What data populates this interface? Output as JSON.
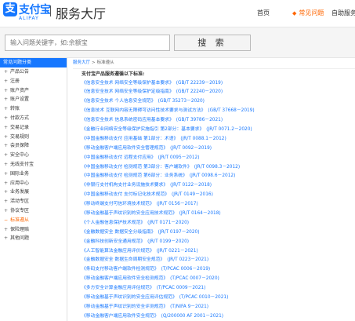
{
  "header": {
    "logo_mark": "支",
    "logo_cn": "支付宝",
    "logo_en": "ALIPAY",
    "site_title": "服务大厅",
    "nav": {
      "home": "首页",
      "faq": "常见问题",
      "self_service": "自助服务"
    }
  },
  "search": {
    "placeholder": "输入问题关键字，如:余额宝",
    "button": "搜 索"
  },
  "sidebar": {
    "title": "常见问题分类",
    "items": [
      "产品公告",
      "注册",
      "账户资产",
      "账户设置",
      "转账",
      "付款方式",
      "交易记录",
      "交易规则",
      "会员保障",
      "安全中心",
      "无线支付宝",
      "国际业务",
      "应用中心",
      "业务发展",
      "活动专区",
      "协议专区",
      "标准遵从",
      "保险理赔",
      "其他问题"
    ],
    "active_index": 16
  },
  "breadcrumb": {
    "root": "服务大厅",
    "separator": ">",
    "current": "标准遵从"
  },
  "content": {
    "intro": "支付宝产品服务遵循以下标准:",
    "standards": [
      {
        "name": "《信息安全技术 网络安全等级保护基本要求》",
        "code": "(GB/T 22239－2019)"
      },
      {
        "name": "《信息安全技术 网络安全等级保护定级指南》",
        "code": "(GB/T 22240－2020)"
      },
      {
        "name": "《信息安全技术 个人信息安全规范》",
        "code": "(GB/T 35273－2020)"
      },
      {
        "name": "《信息技术 互联网内容无障碍可访问性技术要求与测试方法》",
        "code": "(GB/T 37668－2019)"
      },
      {
        "name": "《信息安全技术 信息系统密码应用基本要求》",
        "code": "(GB/T 39786－2021)"
      },
      {
        "name": "《金融行业网络安全等级保护实施指引 第2部分：基本要求》",
        "code": "(JR/T 0071.2－2020)"
      },
      {
        "name": "《中国金融移动支付 应用基础 第1部分：术语》",
        "code": "(JR/T 0088.1－2012)"
      },
      {
        "name": "《移动金融客户端应用软件安全管理规范》",
        "code": "(JR/T 0092－2019)"
      },
      {
        "name": "《中国金融移动支付 远程支付应用》",
        "code": "(JR/T 0095－2012)"
      },
      {
        "name": "《中国金融移动支付 检测规范 第3部分：客户端软件》",
        "code": "(JR/T 0098.3－2012)"
      },
      {
        "name": "《中国金融移动支付 检测规范 第6部分：业务系统》",
        "code": "(JR/T 0098.6－2012)"
      },
      {
        "name": "《非银行支付机构支付业务设施技术要求》",
        "code": "(JR/T 0122－2018)"
      },
      {
        "name": "《中国金融移动支付 支付标记化技术规范》",
        "code": "(JR/T 0149－2016)"
      },
      {
        "name": "《移动终端支付可信环境技术规范》",
        "code": "(JR/T 0156－2017)"
      },
      {
        "name": "《移动金融基于声纹识别的安全应用技术规范》",
        "code": "(JR/T 0164－2018)"
      },
      {
        "name": "《个人金融信息保护技术规范》",
        "code": "(JR/T 0171－2020)"
      },
      {
        "name": "《金融数据安全 数据安全分级指南》",
        "code": "(JR/T 0197－2020)"
      },
      {
        "name": "《金融科技创新安全通用规范》",
        "code": "(JR/T 0199－2020)"
      },
      {
        "name": "《人工智能算法金融应用评价规范》",
        "code": "(JR/T 0221－2021)"
      },
      {
        "name": "《金融数据安全 数据生命周期安全规范》",
        "code": "(JR/T 0223－2021)"
      },
      {
        "name": "《条码支付移动客户端软件检测规范》",
        "code": "(T/PCAC 0006－2019)"
      },
      {
        "name": "《移动金融客户端应用软件安全检测规范》",
        "code": "(T/PCAC 0007－2020)"
      },
      {
        "name": "《多方安全计算金融应用评估规范》",
        "code": "(T/PCAC 0009－2021)"
      },
      {
        "name": "《移动金融基于声纹识别的安全应用评估规范》",
        "code": "(T/PCAC 0010－2021)"
      },
      {
        "name": "《移动金融基于声纹识别的安全评测规范》",
        "code": "(T/NIFA 9－2021)"
      },
      {
        "name": "《移动金融客户端应用软件安全规范》",
        "code": "(Q/200000 AF 2001－2021)"
      }
    ]
  },
  "colors": {
    "brand": "#1677ff",
    "active": "#ff6600"
  }
}
